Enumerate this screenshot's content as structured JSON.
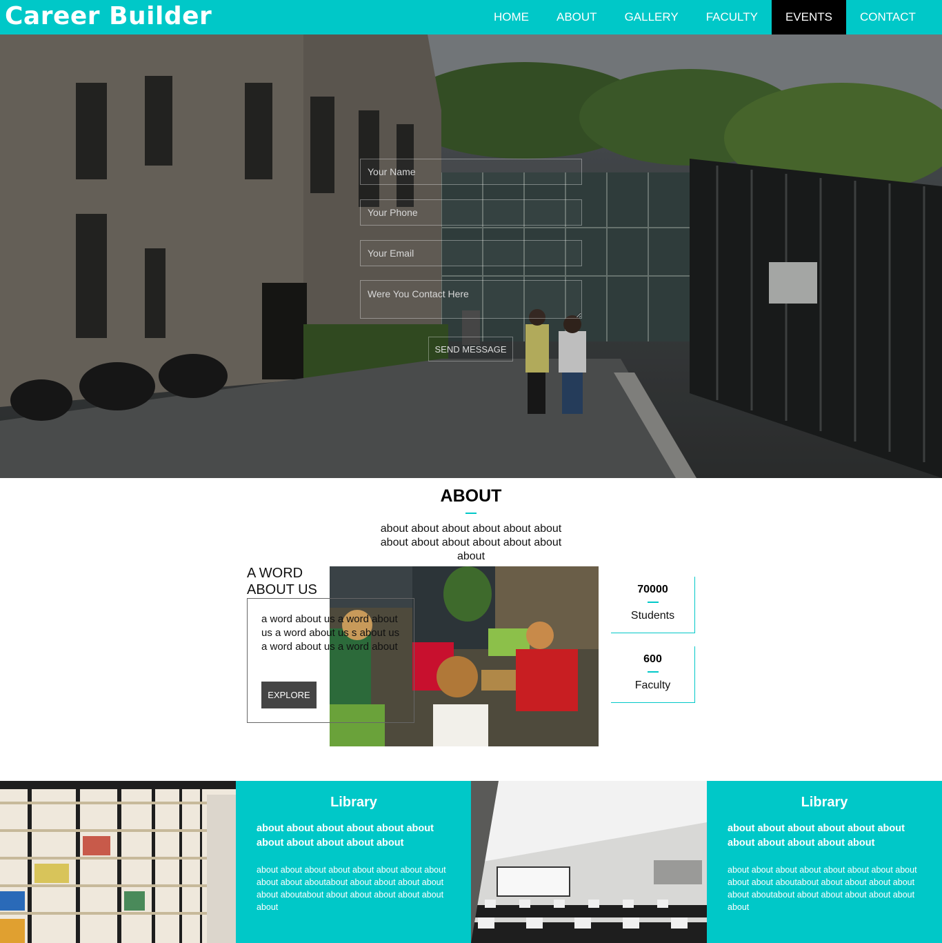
{
  "header": {
    "brand": "Career Builder",
    "menu": [
      {
        "label": "HOME"
      },
      {
        "label": "ABOUT"
      },
      {
        "label": "GALLERY"
      },
      {
        "label": "FACULTY"
      },
      {
        "label": "EVENTS",
        "active": true
      },
      {
        "label": "CONTACT"
      }
    ]
  },
  "hero": {
    "form": {
      "name_placeholder": "Your Name",
      "phone_placeholder": "Your Phone",
      "email_placeholder": "Your Email",
      "message_placeholder": "Were You Contact Here",
      "send_label": "SEND MESSAGE"
    }
  },
  "about": {
    "title": "ABOUT",
    "description": "about about about about about about about about about about about about about",
    "word_title_line1": "A WORD",
    "word_title_line2": "ABOUT US",
    "word_text": "a word about us a word about us a word about us s about us a word about us a word about",
    "explore_label": "EXPLORE",
    "stats": [
      {
        "value": "70000",
        "label": "Students"
      },
      {
        "value": "600",
        "label": "Faculty"
      }
    ]
  },
  "tiles": [
    {
      "title": "Library",
      "subtitle": "about about about about about about about about about about about",
      "body": "about about about about about about about about about about aboutabout about about about about about aboutabout about about about about about about"
    },
    {
      "title": "Library",
      "subtitle": "about about about about about about about about about about about",
      "body": "about about about about about about about about about about aboutabout about about about about about aboutabout about about about about about about"
    }
  ],
  "colors": {
    "accent": "#00c8c8",
    "active_nav": "#000000",
    "button": "#444444"
  }
}
